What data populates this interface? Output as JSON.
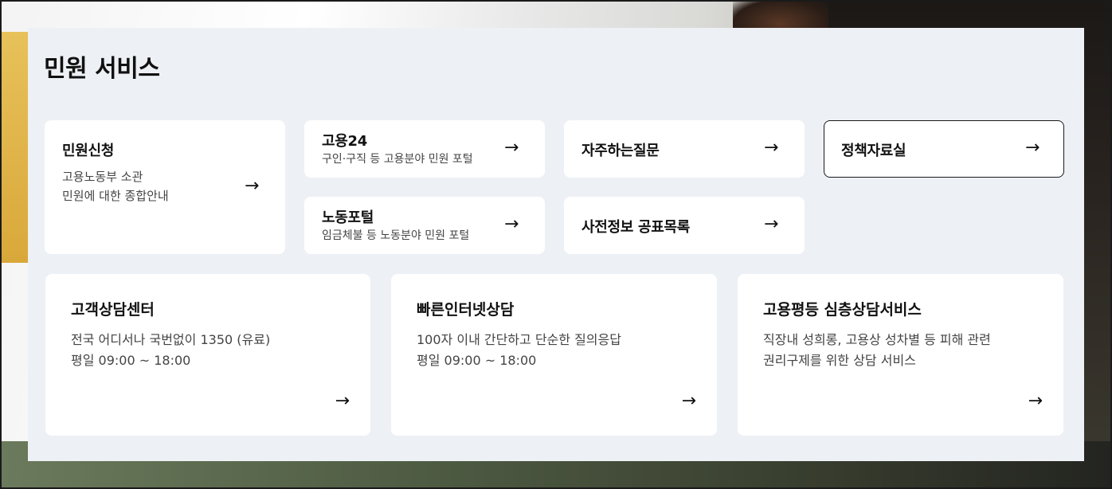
{
  "section": {
    "title": "민원 서비스"
  },
  "cards": {
    "civil_request": {
      "title": "민원신청",
      "desc_line1": "고용노동부 소관",
      "desc_line2": "민원에 대한 종합안내"
    },
    "employment24": {
      "title": "고용24",
      "desc": "구인·구직 등 고용분야 민원 포털"
    },
    "faq": {
      "title": "자주하는질문"
    },
    "policy_library": {
      "title": "정책자료실"
    },
    "labor_portal": {
      "title": "노동포털",
      "desc": "임금체불 등 노동분야 민원 포털"
    },
    "prior_disclosure": {
      "title": "사전정보 공표목록"
    }
  },
  "big_cards": {
    "customer_center": {
      "title": "고객상담센터",
      "desc_line1": "전국 어디서나 국번없이 1350 (유료)",
      "desc_line2": "평일 09:00 ~ 18:00"
    },
    "quick_online": {
      "title": "빠른인터넷상담",
      "desc_line1": "100자 이내 간단하고 단순한 질의응답",
      "desc_line2": "평일 09:00 ~ 18:00"
    },
    "equality": {
      "title": "고용평등 심층상담서비스",
      "desc_line1": "직장내 성희롱, 고용상 성차별 등 피해 관련",
      "desc_line2": "권리구제를 위한 상담 서비스"
    }
  },
  "icons": {
    "arrow": "→",
    "arrow_name": "arrow-right-icon"
  }
}
